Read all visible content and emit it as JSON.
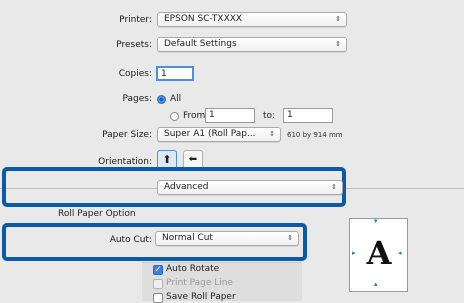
{
  "printer": {
    "label": "Printer:",
    "value": "EPSON SC-TXXXX"
  },
  "presets": {
    "label": "Presets:",
    "value": "Default Settings"
  },
  "copies": {
    "label": "Copies:",
    "value": "1"
  },
  "pages": {
    "label": "Pages:",
    "all_label": "All",
    "from_label": "From:",
    "from_value": "1",
    "to_label": "to:",
    "to_value": "1"
  },
  "paper_size": {
    "label": "Paper Size:",
    "value": "Super A1 (Roll Pap...",
    "dimensions": "610 by 914 mm"
  },
  "orientation": {
    "label": "Orientation:"
  },
  "panel": {
    "value": "Advanced"
  },
  "roll_paper": {
    "section_label": "Roll Paper Option",
    "auto_cut_label": "Auto Cut:",
    "auto_cut_value": "Normal Cut",
    "auto_rotate_label": "Auto Rotate",
    "print_page_line_label": "Print Page Line",
    "save_roll_paper_label": "Save Roll Paper"
  },
  "preview": {
    "glyph": "A"
  },
  "colors": {
    "highlight": "#0b5aa8",
    "accent": "#3f80d8"
  }
}
